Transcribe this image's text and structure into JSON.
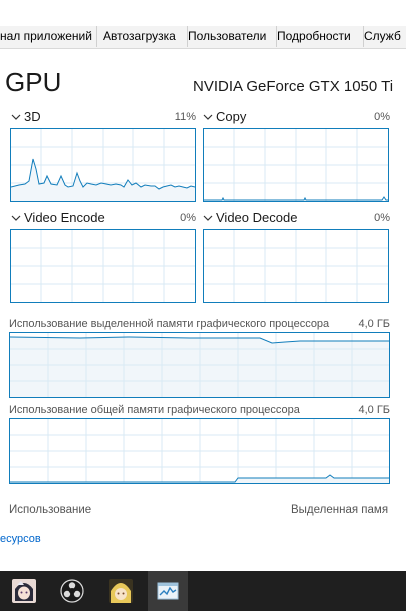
{
  "tabs": [
    {
      "id": "apps-history",
      "label": "нал приложений"
    },
    {
      "id": "startup",
      "label": "Автозагрузка"
    },
    {
      "id": "users",
      "label": "Пользователи"
    },
    {
      "id": "details",
      "label": "Подробности"
    },
    {
      "id": "services",
      "label": "Служб"
    }
  ],
  "gpu": {
    "title": "GPU",
    "model": "NVIDIA GeForce GTX 1050 Ti"
  },
  "engines": [
    {
      "label": "3D",
      "percent": "11%"
    },
    {
      "label": "Copy",
      "percent": "0%"
    },
    {
      "label": "Video Encode",
      "percent": "0%"
    },
    {
      "label": "Video Decode",
      "percent": "0%"
    }
  ],
  "dedicated_memory": {
    "label": "Использование выделенной памяти графического процессора",
    "max": "4,0 ГБ"
  },
  "shared_memory": {
    "label": "Использование общей памяти графического процессора",
    "max": "4,0 ГБ"
  },
  "bottom": {
    "utilization_label": "Использование",
    "dedicated_label": "Выделенная памя",
    "resources_link": "есурсов"
  },
  "colors": {
    "graph_border": "#117dbb",
    "graph_line": "#117dbb",
    "graph_fill": "#f1f6fa",
    "grid": "#d9eaf4",
    "taskbar": "#1f1f1f"
  },
  "taskbar_icons": [
    "anime-avatar-icon",
    "obs-icon",
    "anime-character-icon",
    "task-manager-icon"
  ]
}
